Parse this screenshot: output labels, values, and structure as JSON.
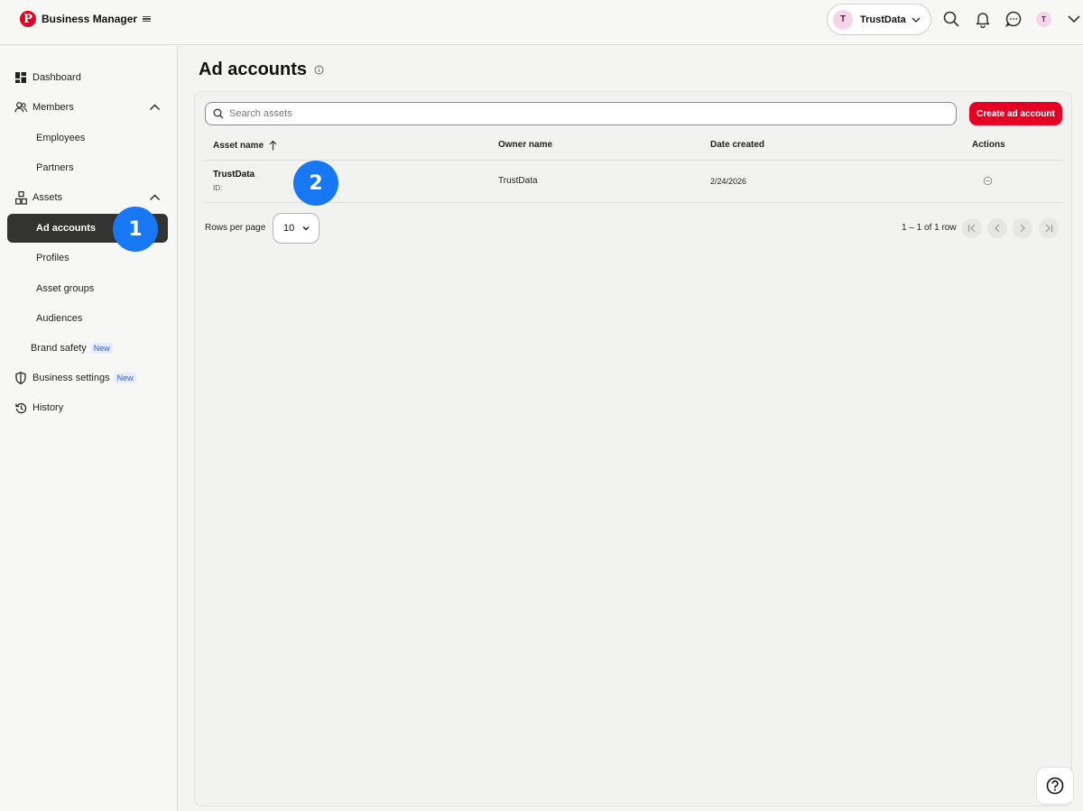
{
  "header": {
    "brand_title": "Business Manager",
    "account_switcher": {
      "avatar_letter": "T",
      "name": "TrustData"
    },
    "profile_avatar_letter": "T",
    "icons": [
      "search-icon",
      "bell-icon",
      "messages-icon",
      "chevron-down-icon"
    ]
  },
  "sidebar": {
    "items": [
      {
        "label": "Dashboard",
        "icon": "dashboard-icon"
      },
      {
        "label": "Members",
        "icon": "members-icon",
        "expanded": true
      },
      {
        "label": "Employees"
      },
      {
        "label": "Partners"
      },
      {
        "label": "Assets",
        "icon": "assets-icon",
        "expanded": true
      },
      {
        "label": "Ad accounts",
        "active": true
      },
      {
        "label": "Profiles"
      },
      {
        "label": "Asset groups"
      },
      {
        "label": "Audiences"
      },
      {
        "label": "Brand safety",
        "badge": "New"
      },
      {
        "label": "Business settings",
        "icon": "shield-icon",
        "badge": "New"
      },
      {
        "label": "History",
        "icon": "history-icon"
      }
    ]
  },
  "main": {
    "title": "Ad accounts",
    "search_placeholder": "Search assets",
    "create_button_label": "Create ad account",
    "table": {
      "columns": [
        "Asset name",
        "Owner name",
        "Date created",
        "Actions"
      ],
      "sort_column": "Asset name",
      "sort_direction": "ascending",
      "rows": [
        {
          "asset_name": "TrustData",
          "id_label": "ID:",
          "owner_name": "TrustData",
          "date_created": "2/24/2026"
        }
      ]
    },
    "pagination": {
      "rows_per_page_label": "Rows per page",
      "rows_per_page_value": "10",
      "range_text": "1 – 1 of 1 row"
    }
  },
  "step_markers": [
    "1",
    "2"
  ],
  "colors": {
    "brand_red": "#e60023",
    "active_nav": "#333331",
    "step_marker_blue": "#1877f2",
    "new_badge": "#2b5fd9"
  }
}
